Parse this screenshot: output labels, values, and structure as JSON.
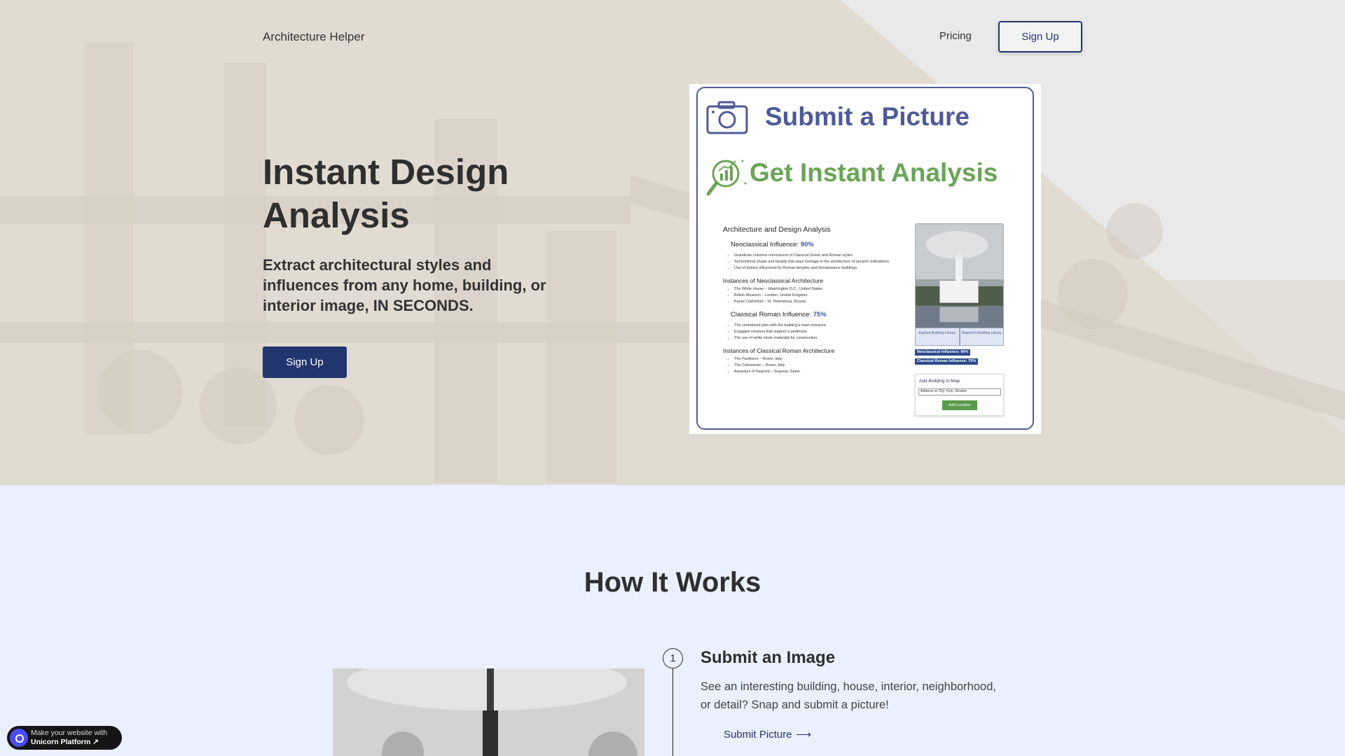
{
  "nav": {
    "brand": "Architecture Helper",
    "pricing": "Pricing",
    "signup": "Sign Up"
  },
  "hero": {
    "title": "Instant Design Analysis",
    "subtitle": "Extract architectural styles and influences from any home, building, or interior image, IN SECONDS.",
    "cta": "Sign Up"
  },
  "preview": {
    "heading1": "Submit a Picture",
    "heading2": "Get Instant Analysis",
    "report_title": "Architecture and Design Analysis",
    "neo_label": "Neoclassical Influence:",
    "neo_value": "90%",
    "neo_points": [
      "Grandiose columns reminiscent of Classical Greek and Roman styles.",
      "Symmetrical shape and facade that pays homage to the architecture of ancient civilizations.",
      "Use of domes influenced by Roman temples and Renaissance buildings."
    ],
    "neo_inst_title": "Instances of Neoclassical Architecture",
    "neo_instances": [
      "The White House – Washington D.C., United States",
      "British Museum – London, United Kingdom",
      "Kazan Cathedral – St. Petersburg, Russia"
    ],
    "rom_label": "Classical Roman Influence:",
    "rom_value": "75%",
    "rom_points": [
      "The centralized plan with the building's main entrance.",
      "Engaged columns that support a pediment.",
      "The use of white stone materials for construction."
    ],
    "rom_inst_title": "Instances of Classical Roman Architecture",
    "rom_instances": [
      "The Pantheon – Rome, Italy",
      "The Colosseum – Rome, Italy",
      "Aqueduct of Segovia – Segovia, Spain"
    ],
    "btn_explore": "Explore Building Library",
    "btn_shared": "Shared in Building Library",
    "badge1": "Neoclassical Influence: 90%",
    "badge2": "Classical Roman Influence: 75%",
    "map_title": "Add Building to Map",
    "map_value": "Address or City: Kyiv, Ukraine",
    "map_btn": "Add Location"
  },
  "how": {
    "title": "How It Works",
    "step_number": "1",
    "step_title": "Submit an Image",
    "step_desc": "See an interesting building, house, interior, neighborhood, or detail? Snap and submit a picture!",
    "step_link": "Submit Picture",
    "step_link_arrow": "⟶"
  },
  "badge": {
    "line1": "Make your website with",
    "line2": "Unicorn Platform ↗"
  },
  "colors": {
    "primary": "#23356e",
    "accent_blue": "#4f5b96",
    "accent_green": "#6aa556",
    "section_bg": "#eaf0fd"
  }
}
